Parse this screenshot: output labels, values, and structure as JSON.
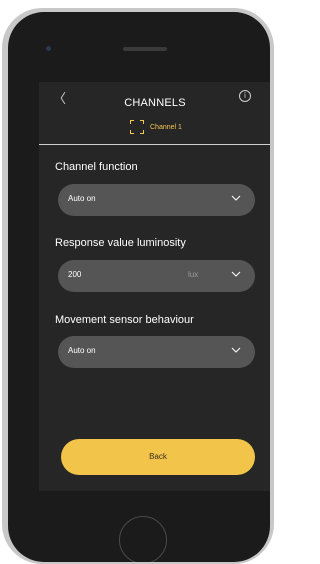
{
  "header": {
    "back_glyph": "〈",
    "title": "CHANNELS",
    "info_glyph": "i",
    "channel_label": "Channel 1"
  },
  "fields": [
    {
      "label": "Channel function",
      "value": "Auto on",
      "unit": ""
    },
    {
      "label": "Response value luminosity",
      "value": "200",
      "unit": "lux"
    },
    {
      "label": "Movement sensor behaviour",
      "value": "Auto on",
      "unit": ""
    }
  ],
  "footer": {
    "back_label": "Back"
  },
  "colors": {
    "accent": "#f2c44a",
    "screen_bg": "#262626",
    "field_bg": "#555555"
  }
}
